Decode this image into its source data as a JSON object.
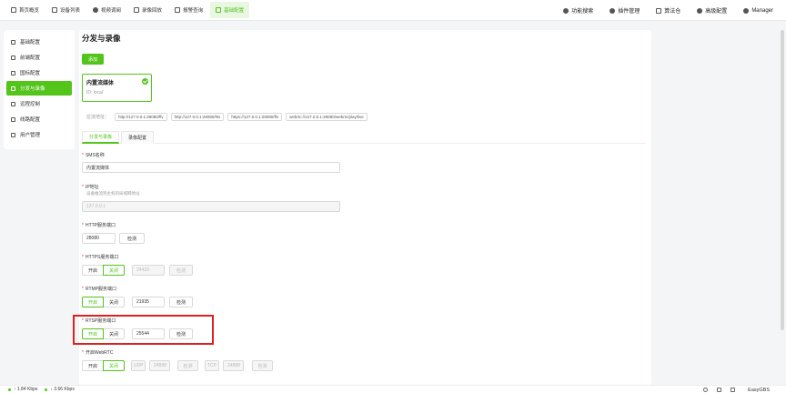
{
  "nav": {
    "items": [
      {
        "label": "首页概览",
        "icon": "home-icon"
      },
      {
        "label": "设备列表",
        "icon": "device-list-icon"
      },
      {
        "label": "视频调阅",
        "icon": "video-icon"
      },
      {
        "label": "录像回放",
        "icon": "cloud-playback-icon"
      },
      {
        "label": "报警查询",
        "icon": "alarm-bell-icon"
      },
      {
        "label": "基础配置",
        "icon": "config-edit-icon",
        "active": true
      }
    ],
    "right": [
      {
        "label": "功能搜索",
        "icon": "search-icon"
      },
      {
        "label": "插件管理",
        "icon": "plugin-icon"
      },
      {
        "label": "算法仓",
        "icon": "algorithm-box-icon"
      },
      {
        "label": "高级配置",
        "icon": "gear-icon"
      },
      {
        "label": "Manager",
        "icon": "user-icon"
      }
    ]
  },
  "sidebar": {
    "items": [
      {
        "label": "基础配置"
      },
      {
        "label": "前端配置"
      },
      {
        "label": "国标配置"
      },
      {
        "label": "分发与录像",
        "active": true
      },
      {
        "label": "远程控制"
      },
      {
        "label": "线路配置"
      },
      {
        "label": "用户管理"
      }
    ]
  },
  "main": {
    "title": "分发与录像",
    "add_label": "添加",
    "card": {
      "name": "内置流媒体",
      "id": "ID: local"
    },
    "addr_label": "拉流地址：",
    "addrs": [
      "http://127.0.0.1:28080/flv",
      "http://127.0.0.1:28080/hls",
      "https://127.0.0.1:28080/flv",
      "webrtc://127.0.0.1:28080/webrtc/play/live"
    ],
    "tabs": [
      "分发与录像",
      "录像配置"
    ],
    "sms_name": {
      "label": "SMS名称",
      "value": "内置流媒体"
    },
    "ip": {
      "label": "IP地址",
      "hint": "设备推流到主机的局域网地址",
      "value": "127.0.0.1"
    },
    "http_port": {
      "label": "HTTP服务端口",
      "value": "28080",
      "detect": "检测"
    },
    "https_port": {
      "label": "HTTPS服务端口",
      "on": "开启",
      "off": "关闭",
      "value": "24433",
      "detect": "检测"
    },
    "rtmp_port": {
      "label": "RTMP服务端口",
      "on": "开启",
      "off": "关闭",
      "value": "21935",
      "detect": "检测"
    },
    "rtsp_port": {
      "label": "RTSP服务端口",
      "on": "开启",
      "off": "关闭",
      "value": "25544",
      "detect": "检测"
    },
    "webrtc": {
      "label": "开启WebRTC",
      "on": "开启",
      "off": "关闭",
      "udp": "UDP",
      "udp_port": "24888",
      "tcp": "TCP",
      "tcp_port": "24888",
      "detect": "检测"
    }
  },
  "status": {
    "up": "↑ 1.84 Kbps",
    "down": "↓ 3.66 Kbps",
    "brand": "EasyGBS"
  }
}
